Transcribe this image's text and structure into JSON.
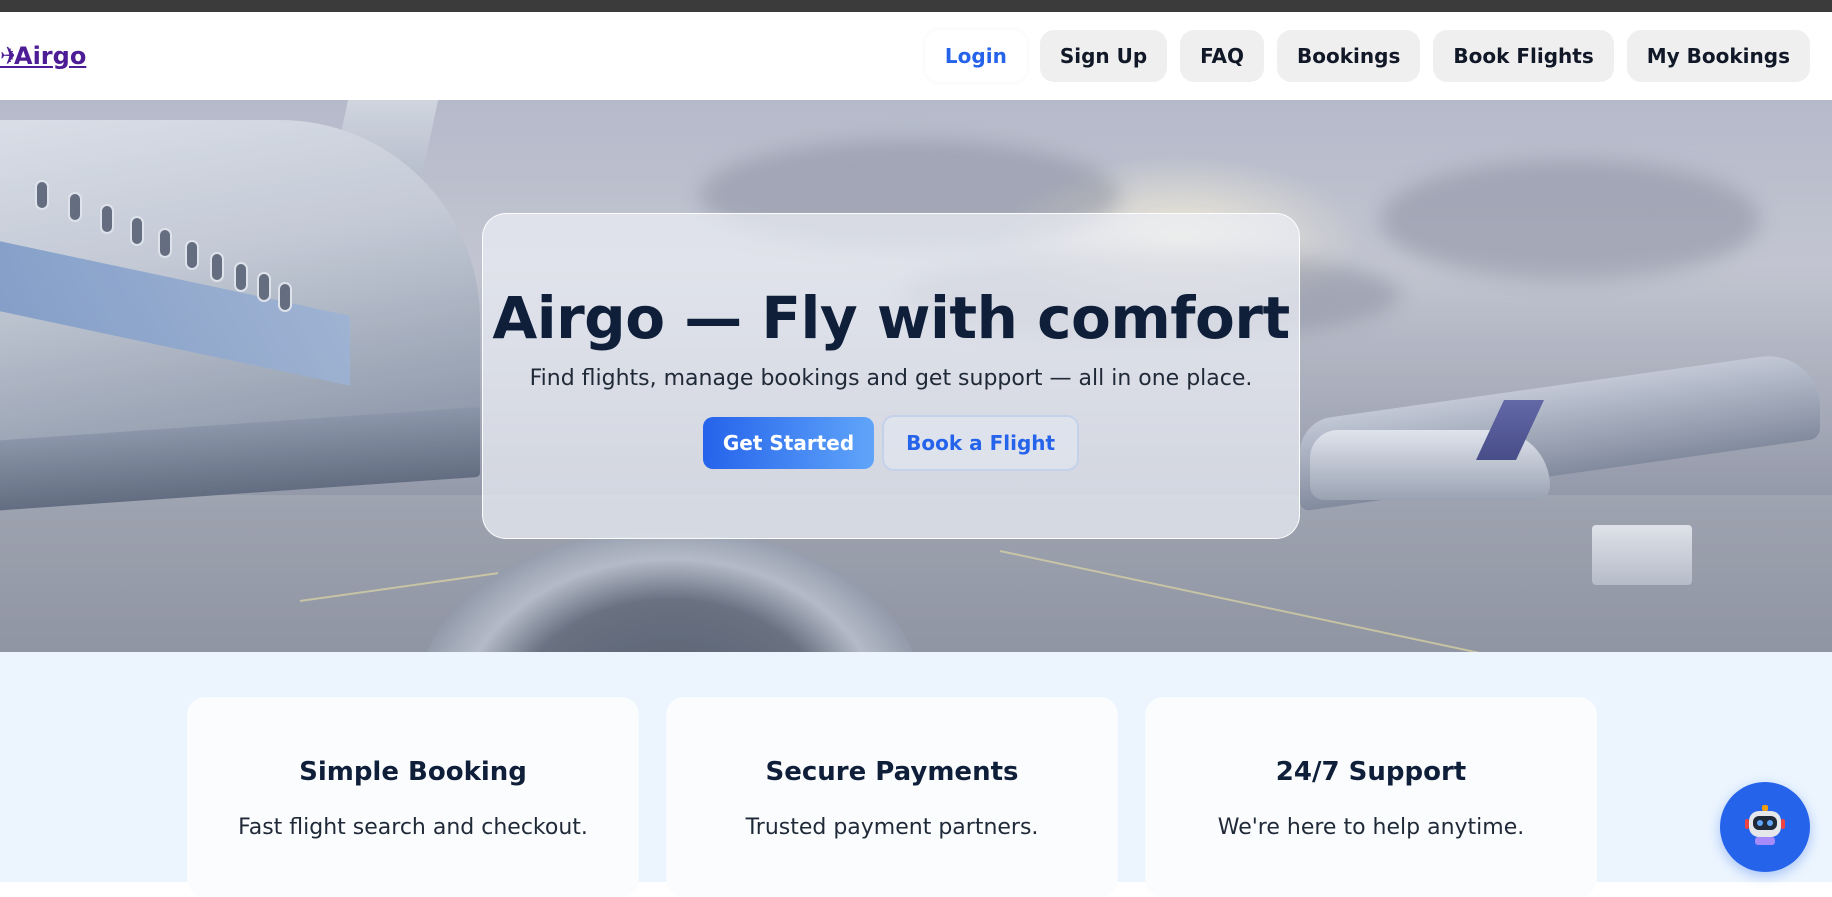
{
  "header": {
    "logo_text": "Airgo",
    "nav": [
      {
        "label": "Login",
        "active": true
      },
      {
        "label": "Sign Up"
      },
      {
        "label": "FAQ"
      },
      {
        "label": "Bookings"
      },
      {
        "label": "Book Flights"
      },
      {
        "label": "My Bookings"
      }
    ]
  },
  "hero": {
    "title": "Airgo — Fly with comfort",
    "subtitle": "Find flights, manage bookings and get support — all in one place.",
    "primary_cta": "Get Started",
    "secondary_cta": "Book a Flight",
    "background": "airport-apron-photo"
  },
  "features": [
    {
      "title": "Simple Booking",
      "description": "Fast flight search and checkout."
    },
    {
      "title": "Secure Payments",
      "description": "Trusted payment partners."
    },
    {
      "title": "24/7 Support",
      "description": "We're here to help anytime."
    }
  ],
  "chatbot": {
    "icon": "robot-icon"
  },
  "colors": {
    "accent": "#2563eb",
    "logo": "#4c1d95",
    "features_bg": "#ecf5fe",
    "heading": "#0f1f3a"
  }
}
